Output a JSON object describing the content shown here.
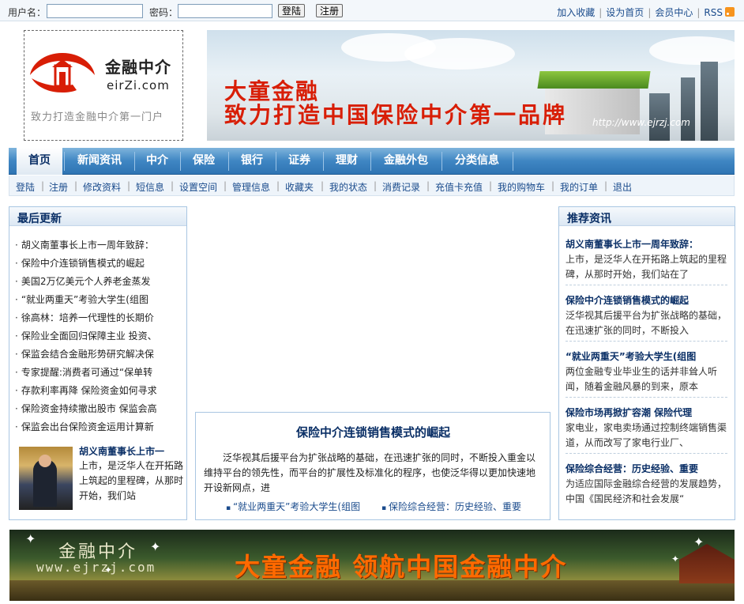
{
  "login": {
    "username_label": "用户名：",
    "password_label": "密码：",
    "username_value": "",
    "password_value": "",
    "login_button": "登陆",
    "register_button": "注册"
  },
  "toplinks": [
    "加入收藏",
    "设为首页",
    "会员中心",
    "RSS"
  ],
  "logo": {
    "name_cn": "金融中介",
    "name_en": "eirZi.com",
    "slogan": "致力打造金融中介第一门户",
    "brand_color": "#d81e06"
  },
  "banner": {
    "line1": "大童金融",
    "line2": "致力打造中国保险中介第一品牌",
    "url": "http://www.ejrzj.com"
  },
  "mainnav": [
    "首页",
    "新闻资讯",
    "中介",
    "保险",
    "银行",
    "证券",
    "理财",
    "金融外包",
    "分类信息"
  ],
  "subnav": [
    "登陆",
    "注册",
    "修改资料",
    "短信息",
    "设置空间",
    "管理信息",
    "收藏夹",
    "我的状态",
    "消费记录",
    "充值卡充值",
    "我的购物车",
    "我的订单",
    "退出"
  ],
  "latest": {
    "title": "最后更新",
    "items": [
      "胡义南董事长上市一周年致辞：",
      "保险中介连锁销售模式的崛起",
      "美国2万亿美元个人养老金蒸发",
      "“就业两重天”考验大学生(组图",
      "徐高林：培养一代理性的长期价",
      "保险业全面回归保障主业 投资、",
      "保监会结合金融形势研究解决保",
      "专家提醒:消费者可通过“保单转",
      "存款利率再降 保险资金如何寻求",
      "保险资金持续撤出股市 保监会高",
      "保监会出台保险资金运用计算新"
    ],
    "featured": {
      "title": "胡义南董事长上市一",
      "text": "上市，是泛华人在开拓路上筑起的里程碑，从那时开始，我们站"
    }
  },
  "center": {
    "title": "保险中介连锁销售模式的崛起",
    "body": "泛华视其后援平台为扩张战略的基础，在迅速扩张的同时，不断投入重金以维持平台的领先性，而平台的扩展性及标准化的程序，也使泛华得以更加快速地开设新网点，进",
    "links": [
      "“就业两重天”考验大学生(组图",
      "保险综合经营：历史经验、重要"
    ]
  },
  "recommend": {
    "title": "推荐资讯",
    "items": [
      {
        "title": "胡义南董事长上市一周年致辞：",
        "desc": "上市，是泛华人在开拓路上筑起的里程碑，从那时开始，我们站在了"
      },
      {
        "title": "保险中介连锁销售模式的崛起",
        "desc": "泛华视其后援平台为扩张战略的基础，在迅速扩张的同时，不断投入"
      },
      {
        "title": "“就业两重天”考验大学生(组图",
        "desc": "两位金融专业毕业生的话并非耸人听闻，随着金融风暴的到来，原本"
      },
      {
        "title": "保险市场再掀扩容潮  保险代理",
        "desc": "家电业，家电卖场通过控制终端销售渠道，从而改写了家电行业厂、"
      },
      {
        "title": "保险综合经营：历史经验、重要",
        "desc": "为适应国际金融综合经营的发展趋势，中国《国民经济和社会发展“"
      }
    ]
  },
  "footer": {
    "logo_cn": "金融中介",
    "logo_en": "www.ejrzj.com",
    "slogan": "大童金融  领航中国金融中介"
  }
}
